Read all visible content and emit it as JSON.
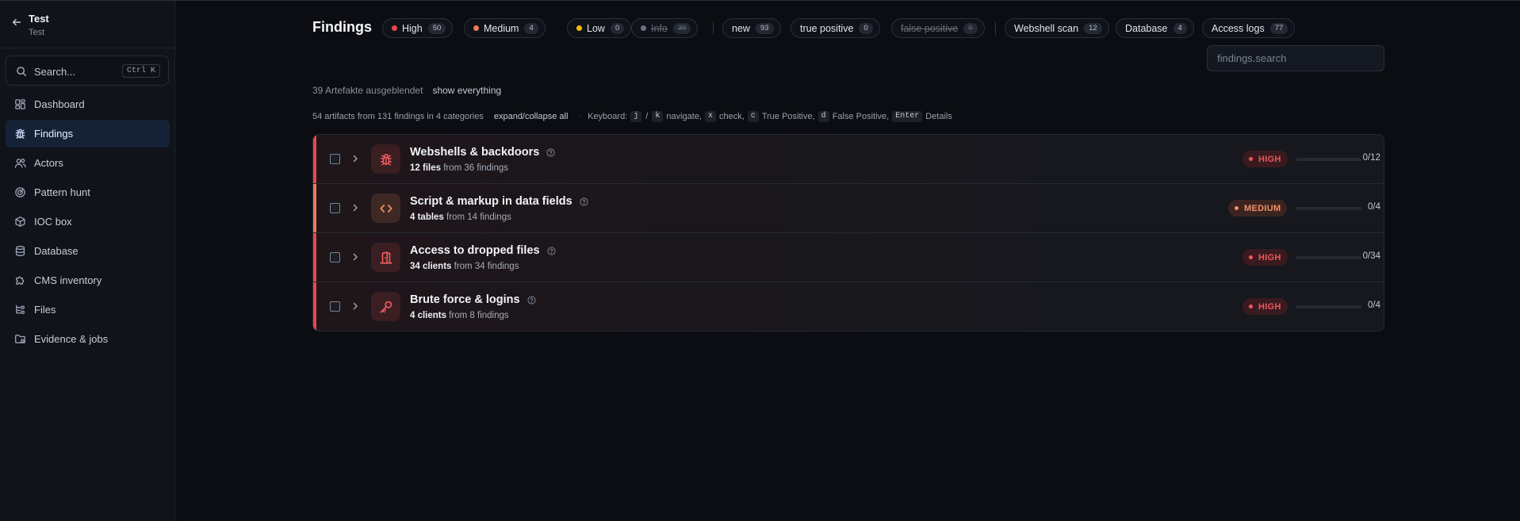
{
  "sidebar": {
    "project_title": "Test",
    "project_subtitle": "Test",
    "search": {
      "label": "Search...",
      "shortcut": "Ctrl K"
    },
    "items": [
      {
        "label": "Dashboard",
        "icon": "dashboard-icon",
        "active": false
      },
      {
        "label": "Findings",
        "icon": "bug-icon",
        "active": true
      },
      {
        "label": "Actors",
        "icon": "users-icon",
        "active": false
      },
      {
        "label": "Pattern hunt",
        "icon": "radar-icon",
        "active": false
      },
      {
        "label": "IOC box",
        "icon": "box-icon",
        "active": false
      },
      {
        "label": "Database",
        "icon": "database-icon",
        "active": false
      },
      {
        "label": "CMS inventory",
        "icon": "puzzle-icon",
        "active": false
      },
      {
        "label": "Files",
        "icon": "files-icon",
        "active": false
      },
      {
        "label": "Evidence & jobs",
        "icon": "folder-icon",
        "active": false
      }
    ]
  },
  "header": {
    "title": "Findings",
    "severity_filters": [
      {
        "label": "High",
        "count": "50",
        "color": "#e5484d",
        "enabled": true
      },
      {
        "label": "Medium",
        "count": "4",
        "color": "#f07b55",
        "enabled": true
      },
      {
        "label": "Low",
        "count": "0",
        "color": "#f5b800",
        "enabled": true
      },
      {
        "label": "Info",
        "count": "39",
        "color": "#6b7180",
        "enabled": false
      }
    ],
    "status_filters": [
      {
        "label": "new",
        "count": "93",
        "enabled": true
      },
      {
        "label": "true positive",
        "count": "0",
        "enabled": true
      },
      {
        "label": "false positive",
        "count": "0",
        "enabled": false
      }
    ],
    "source_filters": [
      {
        "label": "Webshell scan",
        "count": "12"
      },
      {
        "label": "Database",
        "count": "4"
      },
      {
        "label": "Access logs",
        "count": "77"
      }
    ],
    "search_placeholder": "findings.search"
  },
  "hidden_notice": {
    "text": "39 Artefakte ausgeblendet",
    "show_all": "show everything"
  },
  "summary": {
    "text": "54 artifacts from 131 findings in 4 categories",
    "toggle": "expand/collapse all",
    "keyboard_label": "Keyboard:",
    "key_j": "j",
    "key_slash": "/",
    "key_k": "k",
    "navigate": "navigate,",
    "key_x": "x",
    "check": "check,",
    "key_c": "c",
    "true_positive": "True Positive,",
    "key_d": "d",
    "false_positive": "False Positive,",
    "key_enter": "Enter",
    "details": "Details"
  },
  "categories": [
    {
      "title": "Webshells & backdoors",
      "count_bold": "12 files",
      "count_rest": "from 36 findings",
      "severity": "HIGH",
      "icon": "bug-icon",
      "reviewed": 0,
      "total": 12,
      "ratio": "0/12",
      "accent": "#e5484d"
    },
    {
      "title": "Script & markup in data fields",
      "count_bold": "4 tables",
      "count_rest": "from 14 findings",
      "severity": "MEDIUM",
      "icon": "code-icon",
      "reviewed": 0,
      "total": 4,
      "ratio": "0/4",
      "accent": "#f07b55"
    },
    {
      "title": "Access to dropped files",
      "count_bold": "34 clients",
      "count_rest": "from 34 findings",
      "severity": "HIGH",
      "icon": "door-icon",
      "reviewed": 0,
      "total": 34,
      "ratio": "0/34",
      "accent": "#e5484d"
    },
    {
      "title": "Brute force & logins",
      "count_bold": "4 clients",
      "count_rest": "from 8 findings",
      "severity": "HIGH",
      "icon": "key-icon",
      "reviewed": 0,
      "total": 4,
      "ratio": "0/4",
      "accent": "#e5484d"
    }
  ]
}
